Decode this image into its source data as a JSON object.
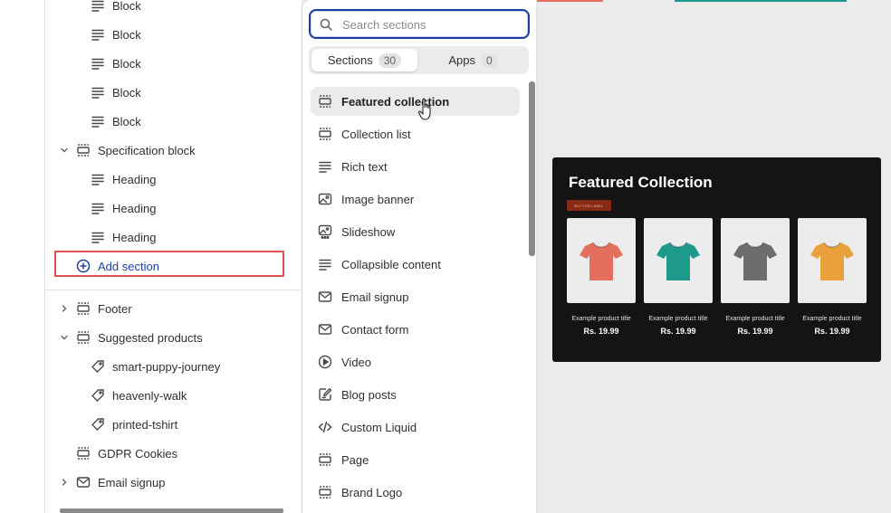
{
  "tree": {
    "items": [
      {
        "label": "Block",
        "icon": "text-block-icon"
      },
      {
        "label": "Block",
        "icon": "text-block-icon"
      },
      {
        "label": "Block",
        "icon": "text-block-icon"
      },
      {
        "label": "Block",
        "icon": "text-block-icon"
      },
      {
        "label": "Block",
        "icon": "text-block-icon"
      },
      {
        "label": "Specification block",
        "icon": "section-icon"
      },
      {
        "label": "Heading",
        "icon": "text-block-icon"
      },
      {
        "label": "Heading",
        "icon": "text-block-icon"
      },
      {
        "label": "Heading",
        "icon": "text-block-icon"
      },
      {
        "label": "Add section",
        "icon": "plus-circle-icon"
      },
      {
        "label": "Footer",
        "icon": "section-icon"
      },
      {
        "label": "Suggested products",
        "icon": "section-icon"
      },
      {
        "label": "smart-puppy-journey",
        "icon": "tag-icon"
      },
      {
        "label": "heavenly-walk",
        "icon": "tag-icon"
      },
      {
        "label": "printed-tshirt",
        "icon": "tag-icon"
      },
      {
        "label": "GDPR Cookies",
        "icon": "section-icon"
      },
      {
        "label": "Email signup",
        "icon": "envelope-icon"
      }
    ]
  },
  "popover": {
    "search_placeholder": "Search sections",
    "tabs": [
      {
        "label": "Sections",
        "count": "30"
      },
      {
        "label": "Apps",
        "count": "0"
      }
    ],
    "sections": [
      {
        "label": "Featured collection",
        "icon": "section-icon"
      },
      {
        "label": "Collection list",
        "icon": "section-icon"
      },
      {
        "label": "Rich text",
        "icon": "text-block-icon"
      },
      {
        "label": "Image banner",
        "icon": "image-icon"
      },
      {
        "label": "Slideshow",
        "icon": "slideshow-icon"
      },
      {
        "label": "Collapsible content",
        "icon": "text-block-icon"
      },
      {
        "label": "Email signup",
        "icon": "envelope-icon"
      },
      {
        "label": "Contact form",
        "icon": "envelope-icon"
      },
      {
        "label": "Video",
        "icon": "play-icon"
      },
      {
        "label": "Blog posts",
        "icon": "edit-icon"
      },
      {
        "label": "Custom Liquid",
        "icon": "code-icon"
      },
      {
        "label": "Page",
        "icon": "section-icon"
      },
      {
        "label": "Brand Logo",
        "icon": "section-icon"
      }
    ]
  },
  "preview": {
    "title": "Featured Collection",
    "button_label": "BUTTON LABEL",
    "products": [
      {
        "title": "Example product title",
        "price": "Rs. 19.99",
        "color": "#e46f5c"
      },
      {
        "title": "Example product title",
        "price": "Rs. 19.99",
        "color": "#1e9a8c"
      },
      {
        "title": "Example product title",
        "price": "Rs. 19.99",
        "color": "#6d6d6d"
      },
      {
        "title": "Example product title",
        "price": "Rs. 19.99",
        "color": "#e9a23b"
      }
    ]
  },
  "colors": {
    "accent": "#1f3fa0",
    "highlight_box": "#e05252"
  }
}
